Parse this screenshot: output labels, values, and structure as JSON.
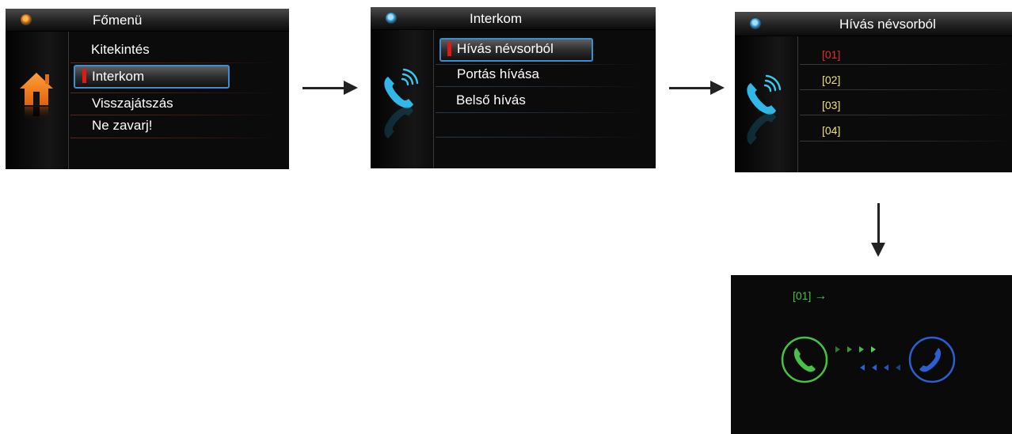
{
  "screen1": {
    "title": "Főmenü",
    "items": [
      "Kitekintés",
      "Interkom",
      "Visszajátszás",
      "Ne zavarj!"
    ],
    "selected": "Interkom"
  },
  "screen2": {
    "title": "Interkom",
    "items": [
      "Hívás névsorból",
      "Portás hívása",
      "Belső hívás"
    ],
    "selected": "Hívás névsorból"
  },
  "screen3": {
    "title": "Hívás névsorból",
    "entries": [
      "[01]",
      "[02]",
      "[03]",
      "[04]"
    ],
    "selected": "[01]"
  },
  "screen4": {
    "call_label": "[01]",
    "call_arrow": "→"
  },
  "colors": {
    "selection_border": "#3a8fd0",
    "marker_red": "#e01818",
    "entry_yellow": "#f2e06a",
    "entry_red": "#e52a2a",
    "call_green": "#47c245",
    "call_blue": "#2c5fd4"
  },
  "icons": {
    "screen1": "home-icon",
    "screen2": "phone-icon",
    "screen3": "phone-icon",
    "screen4_left": "green-phone-icon",
    "screen4_right": "blue-phone-icon"
  }
}
